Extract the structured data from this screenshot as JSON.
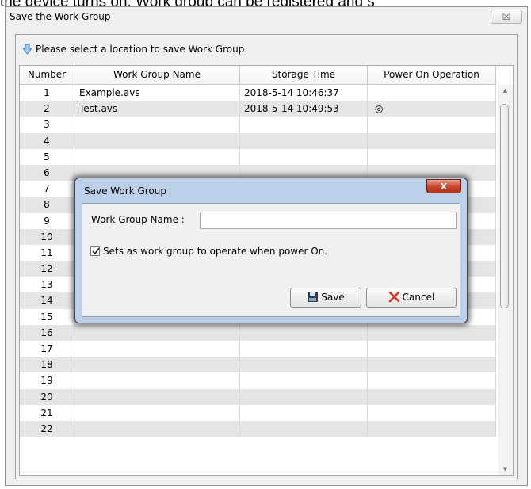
{
  "doc_caption": "the device turns on. Work group can be registered and s",
  "window": {
    "title": "Save the Work Group",
    "close_symbol": "☒"
  },
  "hint": "Please select a location to save Work Group.",
  "table": {
    "headers": [
      "Number",
      "Work Group Name",
      "Storage Time",
      "Power On Operation"
    ],
    "rows": [
      {
        "num": "1",
        "name": "Example.avs",
        "time": "2018-5-14 10:46:37",
        "power": ""
      },
      {
        "num": "2",
        "name": "Test.avs",
        "time": "2018-5-14 10:49:53",
        "power": "◎"
      },
      {
        "num": "3",
        "name": "",
        "time": "",
        "power": ""
      },
      {
        "num": "4",
        "name": "",
        "time": "",
        "power": ""
      },
      {
        "num": "5",
        "name": "",
        "time": "",
        "power": ""
      },
      {
        "num": "6",
        "name": "",
        "time": "",
        "power": ""
      },
      {
        "num": "7",
        "name": "",
        "time": "",
        "power": ""
      },
      {
        "num": "8",
        "name": "",
        "time": "",
        "power": ""
      },
      {
        "num": "9",
        "name": "",
        "time": "",
        "power": ""
      },
      {
        "num": "10",
        "name": "",
        "time": "",
        "power": ""
      },
      {
        "num": "11",
        "name": "",
        "time": "",
        "power": ""
      },
      {
        "num": "12",
        "name": "",
        "time": "",
        "power": ""
      },
      {
        "num": "13",
        "name": "",
        "time": "",
        "power": ""
      },
      {
        "num": "14",
        "name": "",
        "time": "",
        "power": ""
      },
      {
        "num": "15",
        "name": "",
        "time": "",
        "power": ""
      },
      {
        "num": "16",
        "name": "",
        "time": "",
        "power": ""
      },
      {
        "num": "17",
        "name": "",
        "time": "",
        "power": ""
      },
      {
        "num": "18",
        "name": "",
        "time": "",
        "power": ""
      },
      {
        "num": "19",
        "name": "",
        "time": "",
        "power": ""
      },
      {
        "num": "20",
        "name": "",
        "time": "",
        "power": ""
      },
      {
        "num": "21",
        "name": "",
        "time": "",
        "power": ""
      },
      {
        "num": "22",
        "name": "",
        "time": "",
        "power": ""
      }
    ]
  },
  "dialog": {
    "title": "Save Work Group",
    "close_symbol": "X",
    "name_label": "Work Group Name :",
    "name_value": "",
    "checkbox_label": "Sets as work group to operate when power On.",
    "checkbox_checked": true,
    "save_label": "Save",
    "cancel_label": "Cancel"
  },
  "icons": {
    "hint": "down-arrow-icon",
    "save": "floppy-disk-icon",
    "cancel": "red-x-icon",
    "power_on": "target-circle-icon"
  },
  "colors": {
    "dialog_frame": "#bcd0ea",
    "close_button": "#c7452d",
    "alt_row": "#e5e5e5",
    "hint_arrow": "#4a9be0"
  }
}
